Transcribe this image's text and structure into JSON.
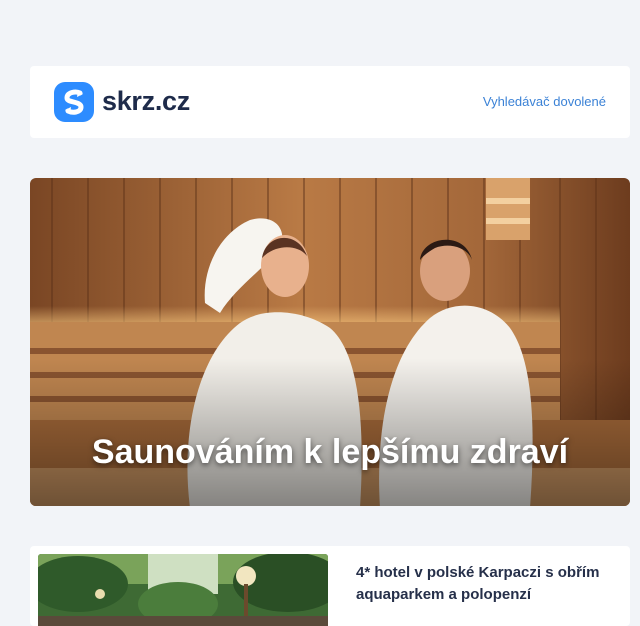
{
  "header": {
    "logo_text": "skrz.cz",
    "nav_link": "Vyhledávač dovolené"
  },
  "hero": {
    "title": "Saunováním k lepšímu zdraví",
    "image": "sauna-women-bathrobes"
  },
  "cards": [
    {
      "title": "4* hotel v polské Karpaczi s obřím aquaparkem a polopenzí",
      "image": "hotel-garden-thumbnail"
    }
  ],
  "colors": {
    "background": "#f2f4f8",
    "brand": "#2d8cff",
    "link": "#3b82d6",
    "logo_text": "#1e2b4a"
  }
}
